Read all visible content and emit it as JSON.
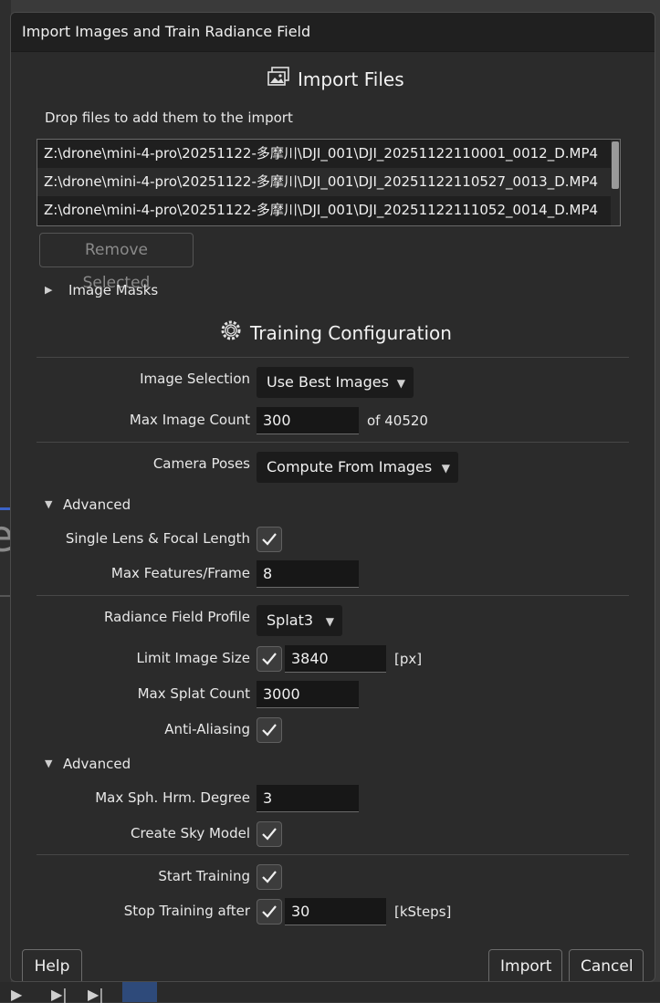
{
  "dialog": {
    "title": "Import Images and Train Radiance Field"
  },
  "import": {
    "heading": "Import Files",
    "drop_hint": "Drop files to add them to the import",
    "files": [
      "Z:\\drone\\mini-4-pro\\20251122-多摩川\\DJI_001\\DJI_20251122110001_0012_D.MP4",
      "Z:\\drone\\mini-4-pro\\20251122-多摩川\\DJI_001\\DJI_20251122110527_0013_D.MP4",
      "Z:\\drone\\mini-4-pro\\20251122-多摩川\\DJI_001\\DJI_20251122111052_0014_D.MP4"
    ],
    "remove_selected": "Remove Selected",
    "image_masks": "Image Masks"
  },
  "training": {
    "heading": "Training Configuration",
    "image_selection": {
      "label": "Image Selection",
      "value": "Use Best Images"
    },
    "max_image_count": {
      "label": "Max Image Count",
      "value": "300",
      "suffix": "of 40520"
    },
    "camera_poses": {
      "label": "Camera Poses",
      "value": "Compute From Images"
    },
    "advanced1": {
      "label": "Advanced",
      "single_lens": {
        "label": "Single Lens & Focal Length",
        "checked": true
      },
      "max_features": {
        "label": "Max Features/Frame",
        "value": "8"
      }
    },
    "profile": {
      "label": "Radiance Field Profile",
      "value": "Splat3"
    },
    "limit_image_size": {
      "label": "Limit Image Size",
      "checked": true,
      "value": "3840",
      "unit": "[px]"
    },
    "max_splat_count": {
      "label": "Max Splat Count",
      "value": "3000"
    },
    "anti_aliasing": {
      "label": "Anti-Aliasing",
      "checked": true
    },
    "advanced2": {
      "label": "Advanced",
      "max_sph": {
        "label": "Max Sph. Hrm. Degree",
        "value": "3"
      },
      "sky_model": {
        "label": "Create Sky Model",
        "checked": true
      }
    },
    "start_training": {
      "label": "Start Training",
      "checked": true
    },
    "stop_training": {
      "label": "Stop Training after",
      "checked": true,
      "value": "30",
      "unit": "[kSteps]"
    }
  },
  "buttons": {
    "help": "Help",
    "import": "Import",
    "cancel": "Cancel"
  },
  "icons": {
    "import_files": "images-import-icon",
    "training": "gear-cube-icon"
  },
  "colors": {
    "dialog_bg": "#2b2b2b",
    "titlebar_bg": "#202020",
    "field_bg": "#171717"
  }
}
